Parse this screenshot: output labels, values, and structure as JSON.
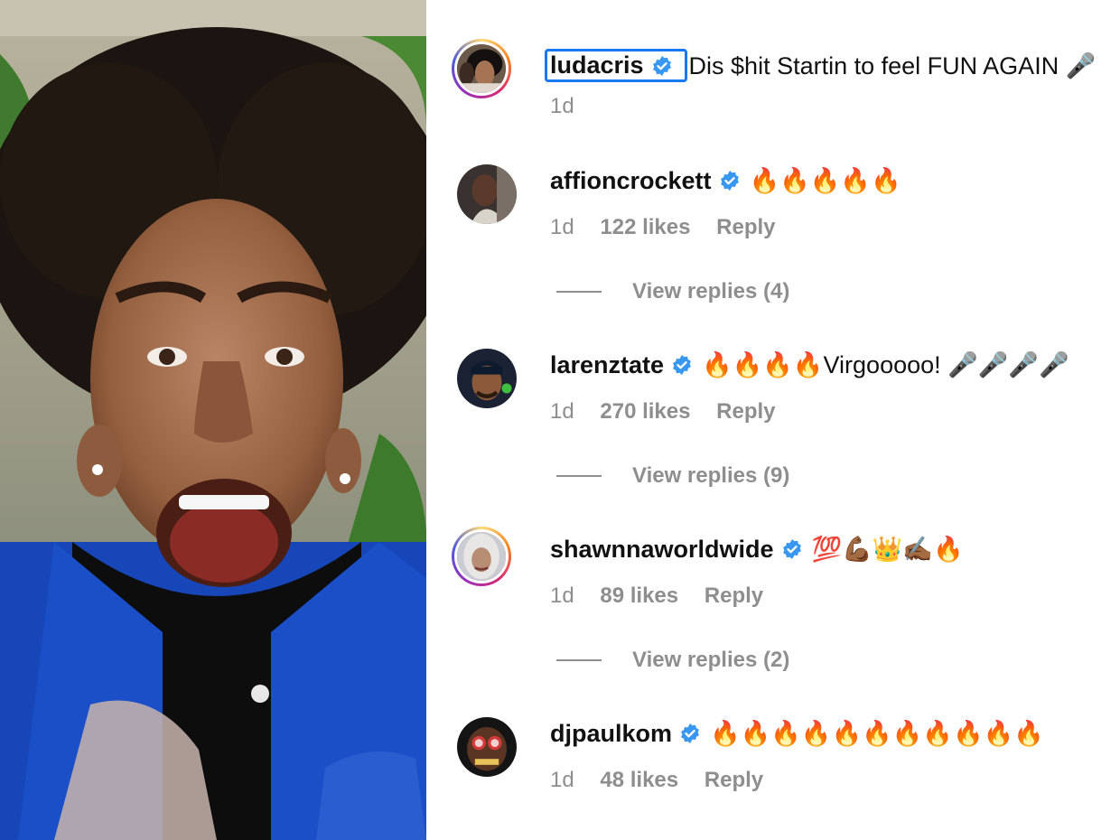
{
  "comments": [
    {
      "username": "ludacris",
      "verified": true,
      "text": "Dis $hit Startin to feel FUN AGAIN 🎤",
      "time": "1d"
    },
    {
      "username": "affioncrockett",
      "verified": true,
      "text": "🔥🔥🔥🔥🔥",
      "time": "1d",
      "likes": "122 likes",
      "reply": "Reply",
      "view_replies": "View replies (4)"
    },
    {
      "username": "larenztate",
      "verified": true,
      "text": "🔥🔥🔥🔥Virgooooo! 🎤🎤🎤🎤",
      "time": "1d",
      "likes": "270 likes",
      "reply": "Reply",
      "view_replies": "View replies (9)"
    },
    {
      "username": "shawnnaworldwide",
      "verified": true,
      "text": "💯💪🏾👑✍🏾🔥",
      "time": "1d",
      "likes": "89 likes",
      "reply": "Reply",
      "view_replies": "View replies (2)"
    },
    {
      "username": "djpaulkom",
      "verified": true,
      "text": "🔥🔥🔥🔥🔥🔥🔥🔥🔥🔥🔥",
      "time": "1d",
      "likes": "48 likes",
      "reply": "Reply"
    }
  ],
  "colors": {
    "verified_blue": "#3897f0",
    "muted": "#8e8e8e",
    "selection": "#1877f2"
  }
}
